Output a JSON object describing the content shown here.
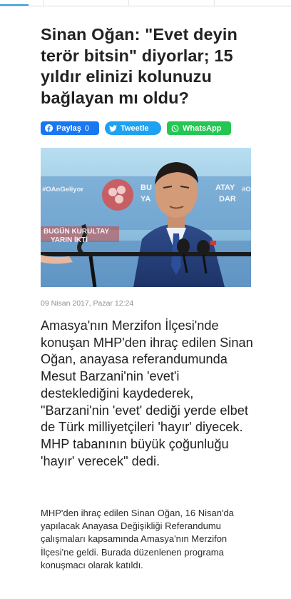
{
  "article": {
    "title": "Sinan Oğan: \"Evet deyin terör bitsin\" diyorlar; 15 yıldır elinizi kolunuzu bağlayan mı oldu?",
    "date": "09 Nisan 2017, Pazar 12:24",
    "lead": "Amasya'nın Merzifon İlçesi'nde konuşan MHP'den ihraç edilen Sinan Oğan, anayasa referandumunda Mesut Barzani'nin 'evet'i desteklediğini kaydederek, \"Barzani'nin 'evet' dediği yerde elbet de Türk milliyetçileri 'hayır' diyecek. MHP tabanının büyük çoğunluğu 'hayır' verecek\" dedi.",
    "body": "MHP'den ihraç edilen Sinan Oğan, 16 Nisan'da yapılacak Anayasa Değişikliği Referandumu çalışmaları kapsamında Amasya'nın Merzifon İlçesi'ne geldi. Burada düzenlenen programa konuşmacı olarak katıldı."
  },
  "share": {
    "facebook_label": "Paylaş",
    "facebook_count": "0",
    "twitter_label": "Tweetle",
    "whatsapp_label": "WhatsApp"
  },
  "photo": {
    "banner_left": "#OAnGeliyor",
    "banner_right_1": "BU",
    "banner_right_2": "ATAY",
    "banner_right_3": "YA",
    "banner_right_4": "DAR",
    "banner_bottom_1": "BUGÜN KURULTAY",
    "banner_bottom_2": "YARIN İKTİ",
    "banner_far_right": "#O"
  },
  "colors": {
    "facebook": "#1877f2",
    "twitter": "#1da1f2",
    "whatsapp": "#25c653"
  }
}
